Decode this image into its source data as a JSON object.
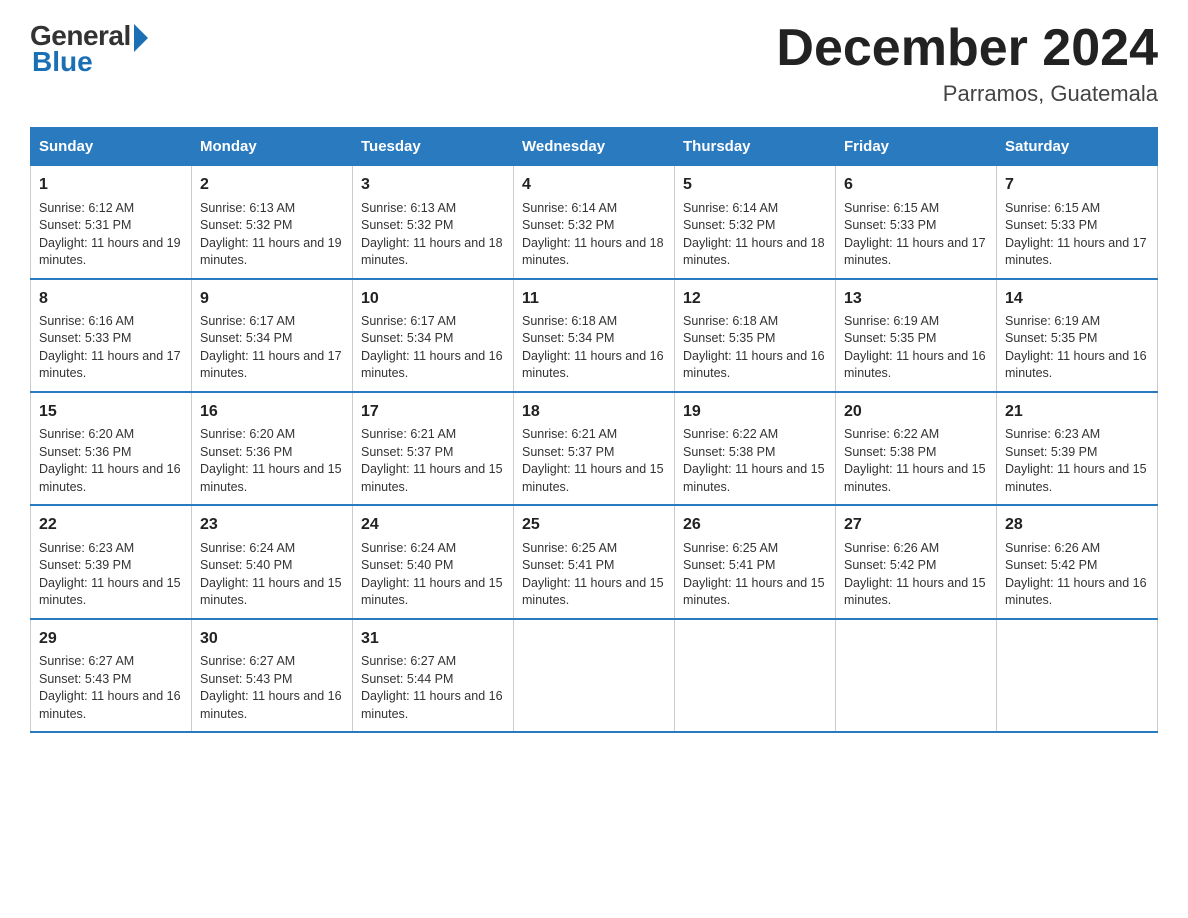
{
  "logo": {
    "general": "General",
    "blue": "Blue"
  },
  "title": {
    "month_year": "December 2024",
    "location": "Parramos, Guatemala"
  },
  "days_header": [
    "Sunday",
    "Monday",
    "Tuesday",
    "Wednesday",
    "Thursday",
    "Friday",
    "Saturday"
  ],
  "weeks": [
    [
      {
        "day": "1",
        "sunrise": "6:12 AM",
        "sunset": "5:31 PM",
        "daylight": "11 hours and 19 minutes."
      },
      {
        "day": "2",
        "sunrise": "6:13 AM",
        "sunset": "5:32 PM",
        "daylight": "11 hours and 19 minutes."
      },
      {
        "day": "3",
        "sunrise": "6:13 AM",
        "sunset": "5:32 PM",
        "daylight": "11 hours and 18 minutes."
      },
      {
        "day": "4",
        "sunrise": "6:14 AM",
        "sunset": "5:32 PM",
        "daylight": "11 hours and 18 minutes."
      },
      {
        "day": "5",
        "sunrise": "6:14 AM",
        "sunset": "5:32 PM",
        "daylight": "11 hours and 18 minutes."
      },
      {
        "day": "6",
        "sunrise": "6:15 AM",
        "sunset": "5:33 PM",
        "daylight": "11 hours and 17 minutes."
      },
      {
        "day": "7",
        "sunrise": "6:15 AM",
        "sunset": "5:33 PM",
        "daylight": "11 hours and 17 minutes."
      }
    ],
    [
      {
        "day": "8",
        "sunrise": "6:16 AM",
        "sunset": "5:33 PM",
        "daylight": "11 hours and 17 minutes."
      },
      {
        "day": "9",
        "sunrise": "6:17 AM",
        "sunset": "5:34 PM",
        "daylight": "11 hours and 17 minutes."
      },
      {
        "day": "10",
        "sunrise": "6:17 AM",
        "sunset": "5:34 PM",
        "daylight": "11 hours and 16 minutes."
      },
      {
        "day": "11",
        "sunrise": "6:18 AM",
        "sunset": "5:34 PM",
        "daylight": "11 hours and 16 minutes."
      },
      {
        "day": "12",
        "sunrise": "6:18 AM",
        "sunset": "5:35 PM",
        "daylight": "11 hours and 16 minutes."
      },
      {
        "day": "13",
        "sunrise": "6:19 AM",
        "sunset": "5:35 PM",
        "daylight": "11 hours and 16 minutes."
      },
      {
        "day": "14",
        "sunrise": "6:19 AM",
        "sunset": "5:35 PM",
        "daylight": "11 hours and 16 minutes."
      }
    ],
    [
      {
        "day": "15",
        "sunrise": "6:20 AM",
        "sunset": "5:36 PM",
        "daylight": "11 hours and 16 minutes."
      },
      {
        "day": "16",
        "sunrise": "6:20 AM",
        "sunset": "5:36 PM",
        "daylight": "11 hours and 15 minutes."
      },
      {
        "day": "17",
        "sunrise": "6:21 AM",
        "sunset": "5:37 PM",
        "daylight": "11 hours and 15 minutes."
      },
      {
        "day": "18",
        "sunrise": "6:21 AM",
        "sunset": "5:37 PM",
        "daylight": "11 hours and 15 minutes."
      },
      {
        "day": "19",
        "sunrise": "6:22 AM",
        "sunset": "5:38 PM",
        "daylight": "11 hours and 15 minutes."
      },
      {
        "day": "20",
        "sunrise": "6:22 AM",
        "sunset": "5:38 PM",
        "daylight": "11 hours and 15 minutes."
      },
      {
        "day": "21",
        "sunrise": "6:23 AM",
        "sunset": "5:39 PM",
        "daylight": "11 hours and 15 minutes."
      }
    ],
    [
      {
        "day": "22",
        "sunrise": "6:23 AM",
        "sunset": "5:39 PM",
        "daylight": "11 hours and 15 minutes."
      },
      {
        "day": "23",
        "sunrise": "6:24 AM",
        "sunset": "5:40 PM",
        "daylight": "11 hours and 15 minutes."
      },
      {
        "day": "24",
        "sunrise": "6:24 AM",
        "sunset": "5:40 PM",
        "daylight": "11 hours and 15 minutes."
      },
      {
        "day": "25",
        "sunrise": "6:25 AM",
        "sunset": "5:41 PM",
        "daylight": "11 hours and 15 minutes."
      },
      {
        "day": "26",
        "sunrise": "6:25 AM",
        "sunset": "5:41 PM",
        "daylight": "11 hours and 15 minutes."
      },
      {
        "day": "27",
        "sunrise": "6:26 AM",
        "sunset": "5:42 PM",
        "daylight": "11 hours and 15 minutes."
      },
      {
        "day": "28",
        "sunrise": "6:26 AM",
        "sunset": "5:42 PM",
        "daylight": "11 hours and 16 minutes."
      }
    ],
    [
      {
        "day": "29",
        "sunrise": "6:27 AM",
        "sunset": "5:43 PM",
        "daylight": "11 hours and 16 minutes."
      },
      {
        "day": "30",
        "sunrise": "6:27 AM",
        "sunset": "5:43 PM",
        "daylight": "11 hours and 16 minutes."
      },
      {
        "day": "31",
        "sunrise": "6:27 AM",
        "sunset": "5:44 PM",
        "daylight": "11 hours and 16 minutes."
      },
      null,
      null,
      null,
      null
    ]
  ],
  "labels": {
    "sunrise": "Sunrise:",
    "sunset": "Sunset:",
    "daylight": "Daylight:"
  }
}
